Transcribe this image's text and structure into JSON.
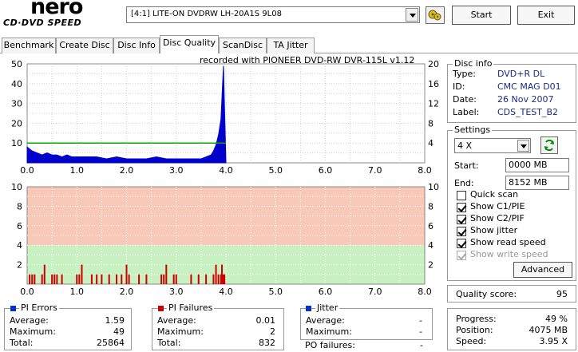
{
  "logo": {
    "brand": "nero",
    "product": "CD·DVD SPEED"
  },
  "drive": {
    "selected": "[4:1]  LITE-ON DVDRW LH-20A1S 9L08"
  },
  "buttons": {
    "start": "Start",
    "exit": "Exit",
    "advanced": "Advanced"
  },
  "tabs": [
    {
      "label": "Benchmark"
    },
    {
      "label": "Create Disc"
    },
    {
      "label": "Disc Info"
    },
    {
      "label": "Disc Quality"
    },
    {
      "label": "ScanDisc"
    },
    {
      "label": "TA Jitter"
    }
  ],
  "active_tab": "Disc Quality",
  "recorded_with": "recorded with PIONEER DVD-RW  DVR-115L v1.12",
  "chart_data": [
    {
      "type": "area",
      "name_hint": "upper",
      "x_ticks": [
        "0.0",
        "1.0",
        "2.0",
        "3.0",
        "4.0",
        "5.0",
        "6.0",
        "7.0",
        "8.0"
      ],
      "y_left_ticks": [
        "50",
        "40",
        "30",
        "20",
        "10"
      ],
      "y_right_ticks": [
        "20",
        "16",
        "12",
        "8",
        "4"
      ],
      "xlim": [
        0,
        8
      ],
      "ylim_left": [
        0,
        50
      ],
      "ylim_right": [
        0,
        20
      ],
      "pie_color": "#0000cc",
      "speed_color": "#00aa00",
      "points_x": [
        0.0,
        0.1,
        0.2,
        0.3,
        0.4,
        0.5,
        0.6,
        0.7,
        0.8,
        0.9,
        1.0,
        1.2,
        1.4,
        1.6,
        1.8,
        2.0,
        2.2,
        2.4,
        2.6,
        2.8,
        3.0,
        3.2,
        3.4,
        3.5,
        3.6,
        3.7,
        3.75,
        3.8,
        3.85,
        3.9,
        3.95,
        4.0
      ],
      "points_pie": [
        8,
        6,
        5,
        4,
        5,
        4,
        4,
        3,
        4,
        3,
        3,
        3,
        3,
        2,
        3,
        2,
        2,
        2,
        3,
        2,
        2,
        2,
        2,
        2,
        3,
        4,
        6,
        9,
        14,
        22,
        49,
        0
      ],
      "speed_x": [
        0.0,
        4.0
      ],
      "speed_y": [
        4.0,
        4.0
      ]
    },
    {
      "type": "bar",
      "name_hint": "lower",
      "x_ticks": [
        "0.0",
        "1.0",
        "2.0",
        "3.0",
        "4.0",
        "5.0",
        "6.0",
        "7.0",
        "8.0"
      ],
      "y_left_ticks": [
        "10",
        "8",
        "6",
        "4",
        "2"
      ],
      "y_right_ticks": [
        "10",
        "8",
        "6",
        "4",
        "2"
      ],
      "xlim": [
        0,
        8
      ],
      "ylim": [
        0,
        10
      ],
      "bar_color": "#cc0000",
      "x": [
        0.05,
        0.1,
        0.15,
        0.3,
        0.35,
        0.5,
        0.55,
        0.6,
        0.7,
        1.0,
        1.05,
        1.1,
        1.3,
        1.4,
        1.5,
        1.65,
        1.8,
        1.9,
        2.0,
        2.05,
        2.25,
        2.4,
        2.7,
        2.75,
        2.8,
        2.95,
        3.0,
        3.3,
        3.45,
        3.6,
        3.75,
        3.8,
        3.85,
        3.9,
        3.92,
        3.95,
        3.97
      ],
      "values": [
        1,
        1,
        1,
        1,
        2,
        1,
        1,
        1,
        1,
        1,
        1,
        2,
        1,
        1,
        1,
        1,
        1,
        1,
        2,
        1,
        1,
        1,
        1,
        1,
        2,
        1,
        1,
        1,
        1,
        1,
        1,
        2,
        1,
        1,
        2,
        1,
        1
      ]
    }
  ],
  "disc_info": {
    "title": "Disc info",
    "rows": [
      {
        "label": "Type:",
        "value": "DVD+R DL"
      },
      {
        "label": "ID:",
        "value": "CMC MAG D01"
      },
      {
        "label": "Date:",
        "value": "26 Nov 2007"
      },
      {
        "label": "Label:",
        "value": "CDS_TEST_B2"
      }
    ]
  },
  "settings": {
    "title": "Settings",
    "speed": "4 X",
    "start_label": "Start:",
    "start_value": "0000 MB",
    "end_label": "End:",
    "end_value": "8152 MB",
    "checkboxes": [
      {
        "label": "Quick scan",
        "checked": false,
        "disabled": false
      },
      {
        "label": "Show C1/PIE",
        "checked": true,
        "disabled": false
      },
      {
        "label": "Show C2/PIF",
        "checked": true,
        "disabled": false
      },
      {
        "label": "Show jitter",
        "checked": true,
        "disabled": false
      },
      {
        "label": "Show read speed",
        "checked": true,
        "disabled": false
      },
      {
        "label": "Show write speed",
        "checked": true,
        "disabled": true
      }
    ]
  },
  "quality": {
    "label": "Quality score:",
    "value": "95"
  },
  "progress": {
    "rows": [
      {
        "label": "Progress:",
        "value": "49 %"
      },
      {
        "label": "Position:",
        "value": "4075 MB"
      },
      {
        "label": "Speed:",
        "value": "3.95 X"
      }
    ]
  },
  "pi_errors": {
    "title": "PI Errors",
    "color": "#0033cc",
    "rows": [
      {
        "label": "Average:",
        "value": "1.59"
      },
      {
        "label": "Maximum:",
        "value": "49"
      },
      {
        "label": "Total:",
        "value": "25864"
      }
    ]
  },
  "pi_failures": {
    "title": "PI Failures",
    "color": "#cc0000",
    "rows": [
      {
        "label": "Average:",
        "value": "0.01"
      },
      {
        "label": "Maximum:",
        "value": "2"
      },
      {
        "label": "Total:",
        "value": "832"
      }
    ]
  },
  "jitter": {
    "title": "Jitter",
    "color": "#0033cc",
    "rows": [
      {
        "label": "Average:",
        "value": "-"
      },
      {
        "label": "Maximum:",
        "value": "-"
      }
    ],
    "po_label": "PO failures:",
    "po_value": "-"
  }
}
